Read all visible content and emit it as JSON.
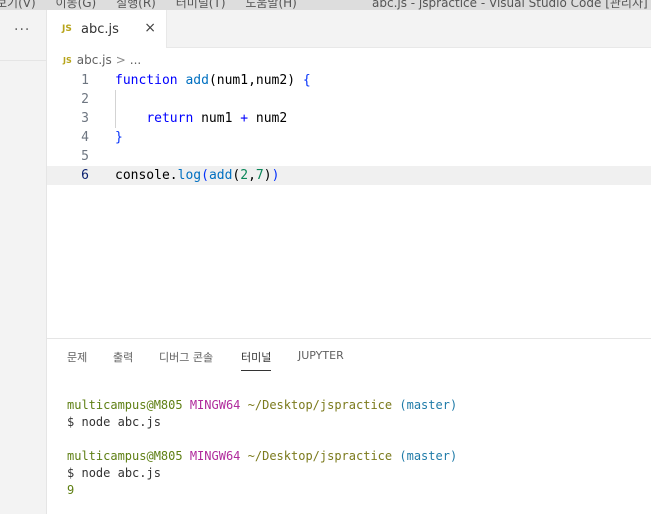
{
  "titlebar": {
    "menu": [
      "보기(V)",
      "이동(G)",
      "실행(R)",
      "터미널(T)",
      "도움말(H)"
    ],
    "window_title": "abc.js - jspractice - Visual Studio Code [관리자]"
  },
  "sidebar": {
    "more_label": "···"
  },
  "tab": {
    "icon_text": "JS",
    "label": "abc.js",
    "close": "×"
  },
  "breadcrumb": {
    "icon_text": "JS",
    "file": "abc.js",
    "sep": ">",
    "more": "..."
  },
  "editor": {
    "active_line": 6,
    "line_numbers": [
      "1",
      "2",
      "3",
      "4",
      "5",
      "6"
    ]
  },
  "panel": {
    "tabs": [
      "문제",
      "출력",
      "디버그 콘솔",
      "터미널",
      "JUPYTER"
    ],
    "active_tab": "터미널"
  },
  "terminal": {
    "user": "multicampus@M805",
    "mingw": "MINGW64",
    "path": "~/Desktop/jspractice",
    "branch": "(master)",
    "prompt": "$",
    "command": "node abc.js",
    "output": "9"
  }
}
